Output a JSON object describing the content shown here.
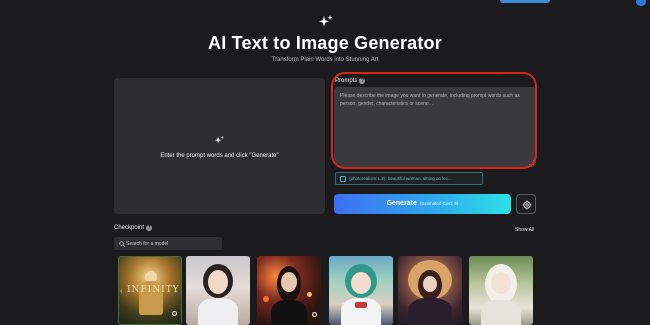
{
  "header": {
    "title": "AI Text to Image Generator",
    "subtitle": "Transform Plain Words into Stunning Art"
  },
  "preview": {
    "hint": "Enter the prompt words and click \"Generate\""
  },
  "prompts": {
    "label": "Prompts",
    "placeholder": "Please describe the image you want to generate, including prompt words such as person, gender, characteristics or scene..."
  },
  "suggestion": {
    "text": "(photorealism:1.2), beautiful woman, sitting on lec..."
  },
  "generate": {
    "label": "Generate",
    "cost": "(Estimated Cost: 6)"
  },
  "checkpoint": {
    "label": "Checkpoint",
    "show_all": "Show All",
    "search_placeholder": "Search for a model"
  },
  "thumbnails": {
    "t1_text": "INFINITY"
  },
  "colors": {
    "background": "#1b1b1d",
    "panel": "#2e2e31",
    "accent_start": "#3e6ff2",
    "accent_end": "#2ee0e6",
    "highlight_ring": "#d3261d"
  },
  "icons": [
    "sparkle-icon",
    "help-icon",
    "suggestion-icon",
    "settings-icon",
    "search-icon",
    "info-icon",
    "chevron-left-icon"
  ]
}
